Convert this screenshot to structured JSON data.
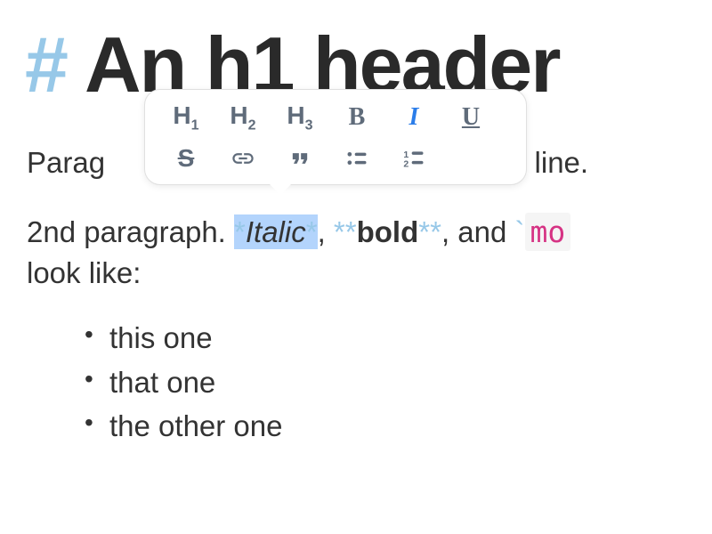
{
  "header": {
    "hash": "#",
    "title": "An h1 header"
  },
  "paragraph1": {
    "prefix": "Parag",
    "suffix": "nk line."
  },
  "paragraph2": {
    "prefix": "2nd paragraph. ",
    "italic_open": "*",
    "italic_word": "Italic",
    "italic_close": "*",
    "sep1": ", ",
    "bold_open": "**",
    "bold_word": "bold",
    "bold_close": "**",
    "sep2": ", and ",
    "backtick": "`",
    "code": "mo",
    "line2": "look like:"
  },
  "list": {
    "items": [
      "this one",
      "that one",
      "the other one"
    ]
  },
  "toolbar": {
    "h1_label": "H",
    "h1_sub": "1",
    "h2_label": "H",
    "h2_sub": "2",
    "h3_label": "H",
    "h3_sub": "3",
    "bold_label": "B",
    "italic_label": "I",
    "underline_label": "U",
    "strike_label": "S"
  }
}
